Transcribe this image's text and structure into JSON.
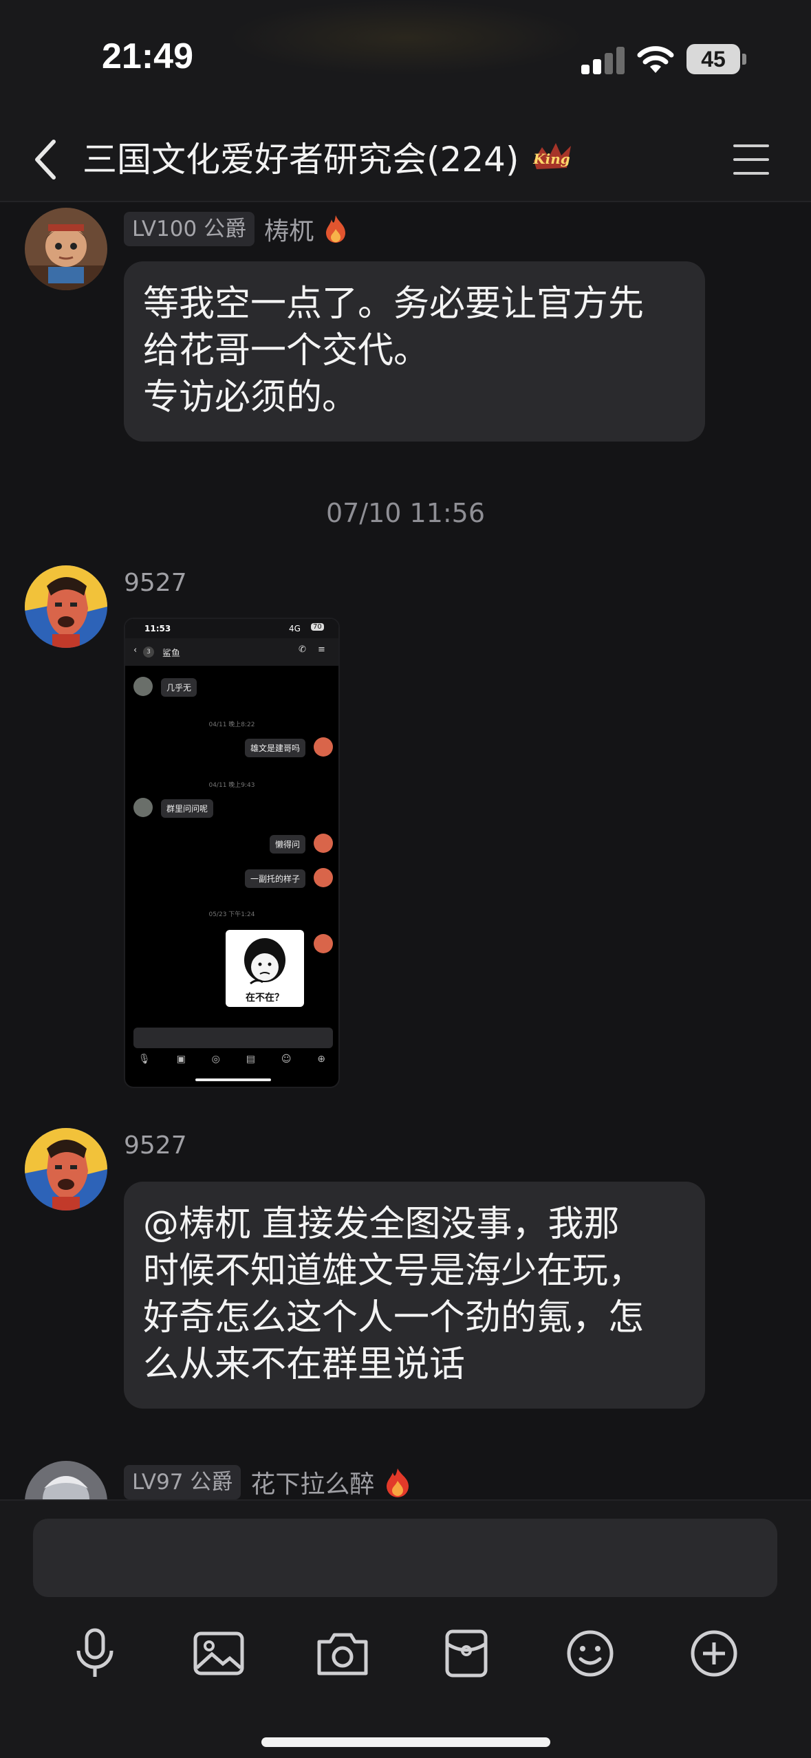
{
  "status_bar": {
    "time": "21:49",
    "battery": "45"
  },
  "header": {
    "title": "三国文化爱好者研究会(224)",
    "badge": "King"
  },
  "messages": [
    {
      "level": "LV100 公爵",
      "name": "梼杌",
      "text": "等我空一点了。务必要让官方先\n给花哥一个交代。\n专访必须的。"
    },
    {
      "timestamp": "07/10 11:56"
    },
    {
      "name": "9527",
      "type": "image"
    },
    {
      "name": "9527",
      "text": "@梼杌 直接发全图没事，我那\n时候不知道雄文号是海少在玩，\n好奇怎么这个人一个劲的氪，怎\n么从来不在群里说话"
    },
    {
      "level": "LV97 公爵",
      "name": "花下拉么醉"
    }
  ],
  "screenshot": {
    "status_time": "11:53",
    "network": "4G",
    "battery": "70",
    "back_count": "3",
    "contact": "鲨鱼",
    "items": [
      {
        "text": "几乎无"
      },
      {
        "time": "04/11 晚上8:22"
      },
      {
        "text": "雄文是建哥吗"
      },
      {
        "time": "04/11 晚上9:43"
      },
      {
        "text": "群里问问呢"
      },
      {
        "text": "懒得问"
      },
      {
        "text": "一副托的样子"
      },
      {
        "time": "05/23 下午1:24"
      },
      {
        "text": "在不在？"
      }
    ]
  },
  "input": {
    "placeholder": ""
  },
  "toolbar": [
    "microphone-icon",
    "image-icon",
    "camera-icon",
    "red-packet-icon",
    "emoji-icon",
    "plus-icon"
  ]
}
